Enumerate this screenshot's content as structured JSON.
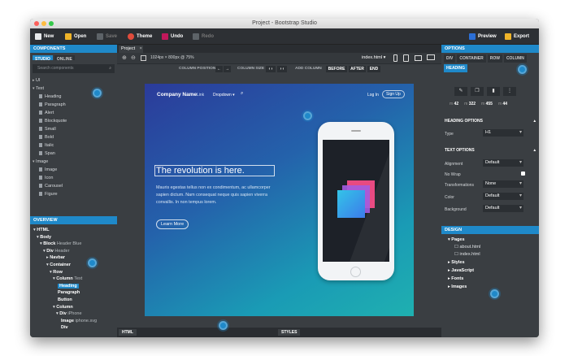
{
  "window": {
    "title": "Project - Bootstrap Studio"
  },
  "toolbar": {
    "new": "New",
    "open": "Open",
    "save": "Save",
    "theme": "Theme",
    "undo": "Undo",
    "redo": "Redo",
    "preview": "Preview",
    "export": "Export"
  },
  "components": {
    "title": "COMPONENTS",
    "tabs": [
      "STUDIO",
      "ONLINE"
    ],
    "search_placeholder": "Search components",
    "groups": [
      {
        "label": "UI",
        "items": []
      },
      {
        "label": "Text",
        "items": [
          "Heading",
          "Paragraph",
          "Alert",
          "Blockquote",
          "Small",
          "Bold",
          "Italic",
          "Span"
        ]
      },
      {
        "label": "Image",
        "items": [
          "Image",
          "Icon",
          "Carousel",
          "Figure"
        ]
      }
    ]
  },
  "overview": {
    "title": "OVERVIEW",
    "tree": [
      {
        "name": "HTML",
        "sub": ""
      },
      {
        "name": "Body",
        "sub": ""
      },
      {
        "name": "Block",
        "sub": "Header Blue"
      },
      {
        "name": "Div",
        "sub": "Header"
      },
      {
        "name": "Navbar",
        "sub": ""
      },
      {
        "name": "Container",
        "sub": ""
      },
      {
        "name": "Row",
        "sub": ""
      },
      {
        "name": "Column",
        "sub": "Text"
      },
      {
        "name": "Heading",
        "sub": ""
      },
      {
        "name": "Paragraph",
        "sub": ""
      },
      {
        "name": "Button",
        "sub": ""
      },
      {
        "name": "Column",
        "sub": ""
      },
      {
        "name": "Div",
        "sub": "iPhone"
      },
      {
        "name": "Image",
        "sub": "iphone.svg"
      },
      {
        "name": "Div",
        "sub": ""
      }
    ]
  },
  "editor": {
    "tab": "Project",
    "resolution": "1024px × 800px @ 75%",
    "page_select": "index.html",
    "column_position": "COLUMN POSITION",
    "column_size": "COLUMN SIZE",
    "add_column": "ADD COLUMN",
    "before": "BEFORE",
    "after": "AFTER",
    "end": "END",
    "bottom_html": "HTML",
    "bottom_styles": "STYLES"
  },
  "site": {
    "brand": "Company Name",
    "nav": [
      "Link",
      "Dropdown"
    ],
    "login": "Log In",
    "signup": "Sign Up",
    "heading": "The revolution is here.",
    "paragraph": "Mauris egestas tellus non ex condimentum, ac ullamcorper sapien dictum. Nam consequat neque quis sapien viverra convallis. In non tempus lorem.",
    "button": "Learn More"
  },
  "options": {
    "title": "OPTIONS",
    "breadcrumbs": [
      "DIV",
      "CONTAINER",
      "ROW",
      "COLUMN",
      "HEADING"
    ],
    "margins": [
      {
        "k": "m",
        "v": "42"
      },
      {
        "k": "m",
        "v": "322"
      },
      {
        "k": "m",
        "v": "455"
      },
      {
        "k": "m",
        "v": "44"
      }
    ],
    "heading_options": "HEADING OPTIONS",
    "type_label": "Type",
    "type_value": "H1",
    "text_options": "TEXT OPTIONS",
    "rows": [
      {
        "label": "Alignment",
        "value": "Default"
      },
      {
        "label": "No Wrap",
        "value": ""
      },
      {
        "label": "Transformations",
        "value": "None"
      },
      {
        "label": "Color",
        "value": "Default"
      },
      {
        "label": "Background",
        "value": "Default"
      }
    ]
  },
  "design": {
    "title": "DESIGN",
    "pages_label": "Pages",
    "pages": [
      "about.html",
      "index.html"
    ],
    "sections": [
      "Styles",
      "JavaScript",
      "Fonts",
      "Images"
    ]
  },
  "colors": {
    "accent": "#1f89c9",
    "panel": "#3a3e42",
    "toolbar": "#2d3034"
  }
}
